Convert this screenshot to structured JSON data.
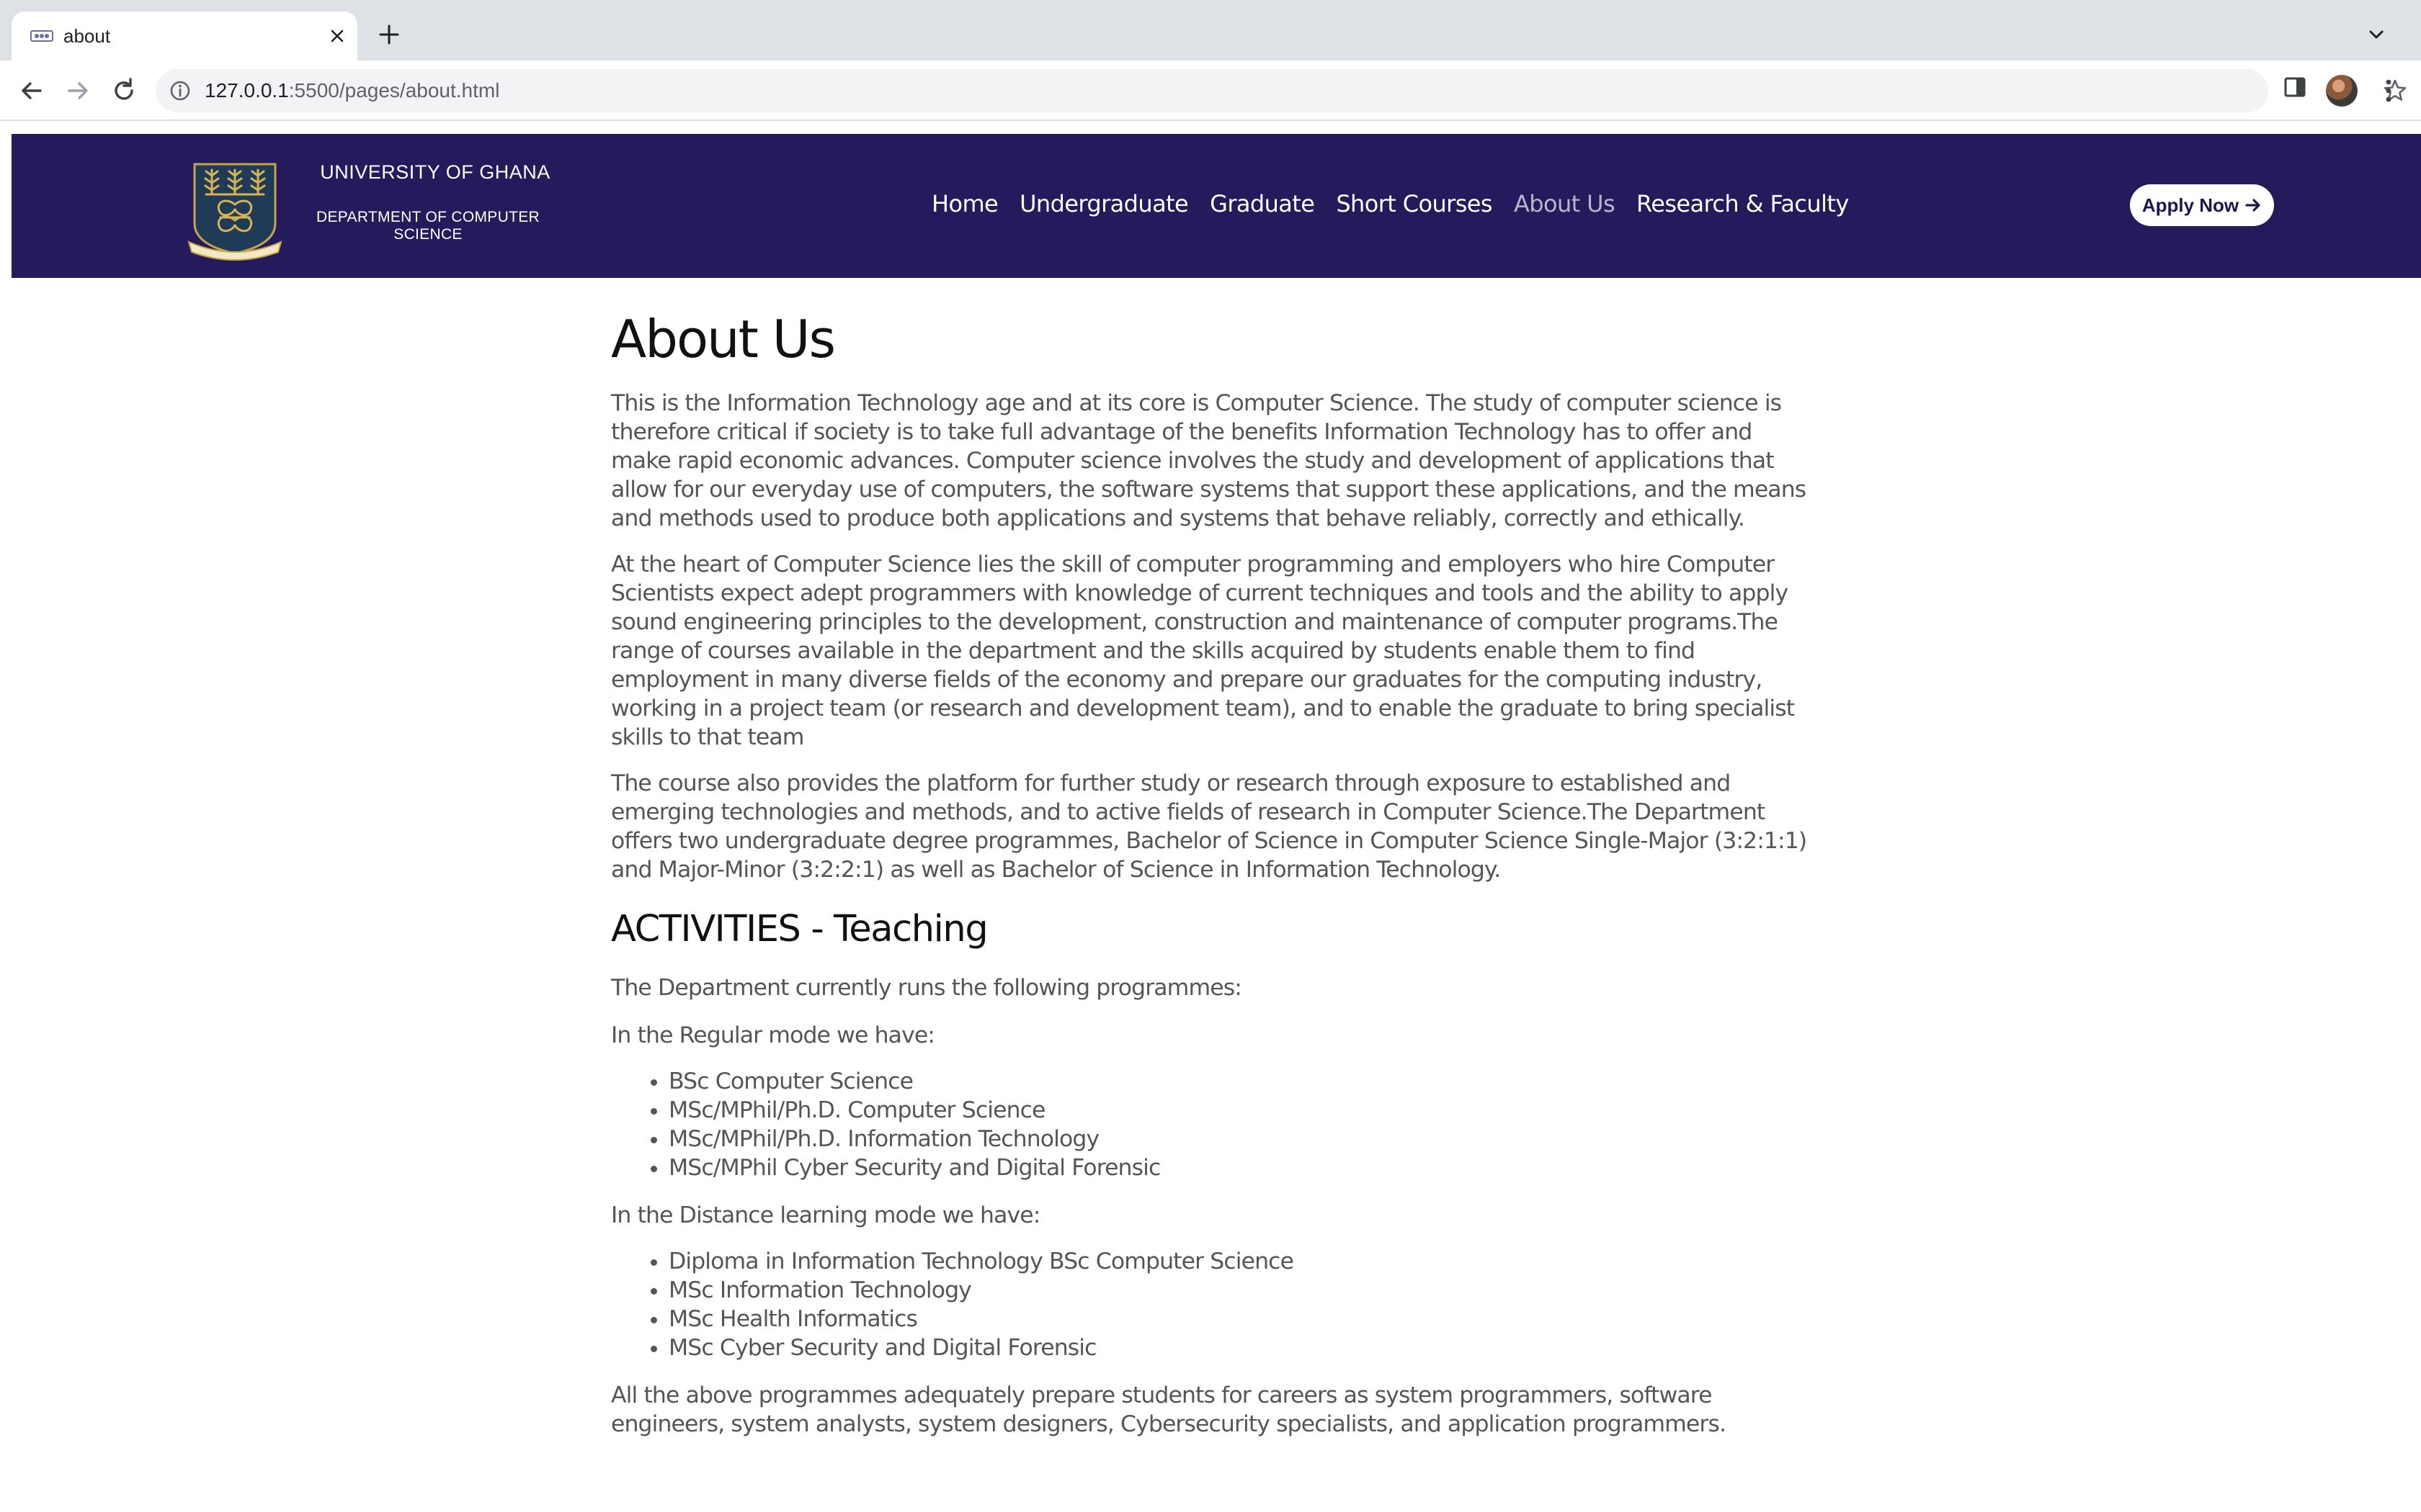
{
  "browser": {
    "tab_title": "about",
    "url_host": "127.0.0.1",
    "url_rest": ":5500/pages/about.html"
  },
  "header": {
    "university": "UNIVERSITY OF GHANA",
    "department": "DEPARTMENT OF COMPUTER SCIENCE",
    "nav": [
      {
        "label": "Home",
        "active": false
      },
      {
        "label": "Undergraduate",
        "active": false
      },
      {
        "label": "Graduate",
        "active": false
      },
      {
        "label": "Short Courses",
        "active": false
      },
      {
        "label": "About Us",
        "active": true
      },
      {
        "label": "Research & Faculty",
        "active": false
      }
    ],
    "apply_label": "Apply Now",
    "brand_color": "#241a5c"
  },
  "main": {
    "title": "About Us",
    "intro_paragraphs": [
      "This is the Information Technology age and at its core is Computer Science. The study of computer science is therefore critical if society is to take full advantage of the benefits Information Technology has to offer and make rapid economic advances. Computer science involves the study and development of applications that allow for our everyday use of computers, the software systems that support these applications, and the means and methods used to produce both applications and systems that behave reliably, correctly and ethically.",
      "At the heart of Computer Science lies the skill of computer programming and employers who hire Computer Scientists expect adept programmers with knowledge of current techniques and tools and the ability to apply sound engineering principles to the development, construction and maintenance of computer programs.The range of courses available in the department and the skills acquired by students enable them to find employment in many diverse fields of the economy and prepare our graduates for the computing industry, working in a project team (or research and development team), and to enable the graduate to bring specialist skills to that team",
      "The course also provides the platform for further study or research through exposure to established and emerging technologies and methods, and to active fields of research in Computer Science.The Department offers two undergraduate degree programmes, Bachelor of Science in Computer Science Single-Major (3:2:1:1) and Major-Minor (3:2:2:1) as well as Bachelor of Science in Information Technology."
    ],
    "activities_heading": "ACTIVITIES - Teaching",
    "programmes_intro": "The Department currently runs the following programmes:",
    "regular_intro": "In the Regular mode we have:",
    "regular_list": [
      "BSc Computer Science",
      "MSc/MPhil/Ph.D. Computer Science",
      "MSc/MPhil/Ph.D. Information Technology",
      "MSc/MPhil Cyber Security and Digital Forensic"
    ],
    "distance_intro": "In the Distance learning mode we have:",
    "distance_list": [
      "Diploma in Information Technology BSc Computer Science",
      "MSc Information Technology",
      "MSc Health Informatics",
      "MSc Cyber Security and Digital Forensic"
    ],
    "closing": "All the above programmes adequately prepare students for careers as system programmers, software engineers, system analysts, system designers, Cybersecurity specialists, and application programmers."
  }
}
